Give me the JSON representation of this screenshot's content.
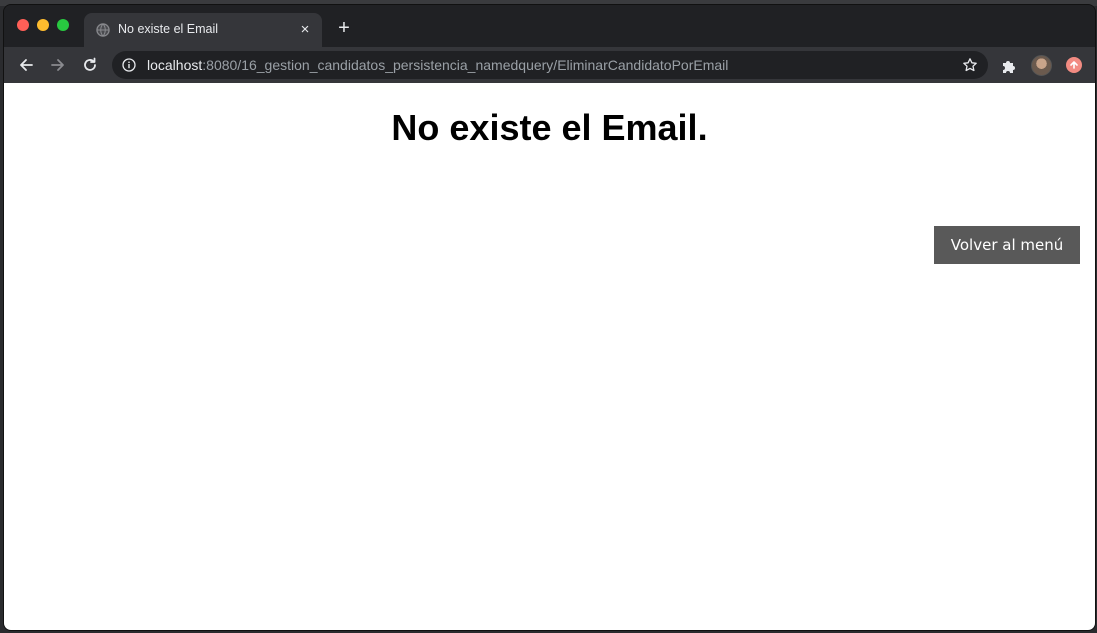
{
  "browser": {
    "tab": {
      "title": "No existe el Email",
      "close_glyph": "×",
      "favicon": "globe-icon"
    },
    "new_tab_glyph": "+",
    "address_bar": {
      "host": "localhost",
      "path": ":8080/16_gestion_candidatos_persistencia_namedquery/EliminarCandidatoPorEmail"
    },
    "icons": [
      "back-arrow-icon",
      "forward-arrow-icon",
      "reload-icon",
      "info-icon",
      "star-icon",
      "puzzle-icon",
      "avatar",
      "update-icon"
    ]
  },
  "page": {
    "heading": "No existe el Email.",
    "back_button_label": "Volver al menú"
  },
  "colors": {
    "button_bg": "#595959",
    "chrome_dark": "#202124",
    "chrome_toolbar": "#35363a"
  }
}
